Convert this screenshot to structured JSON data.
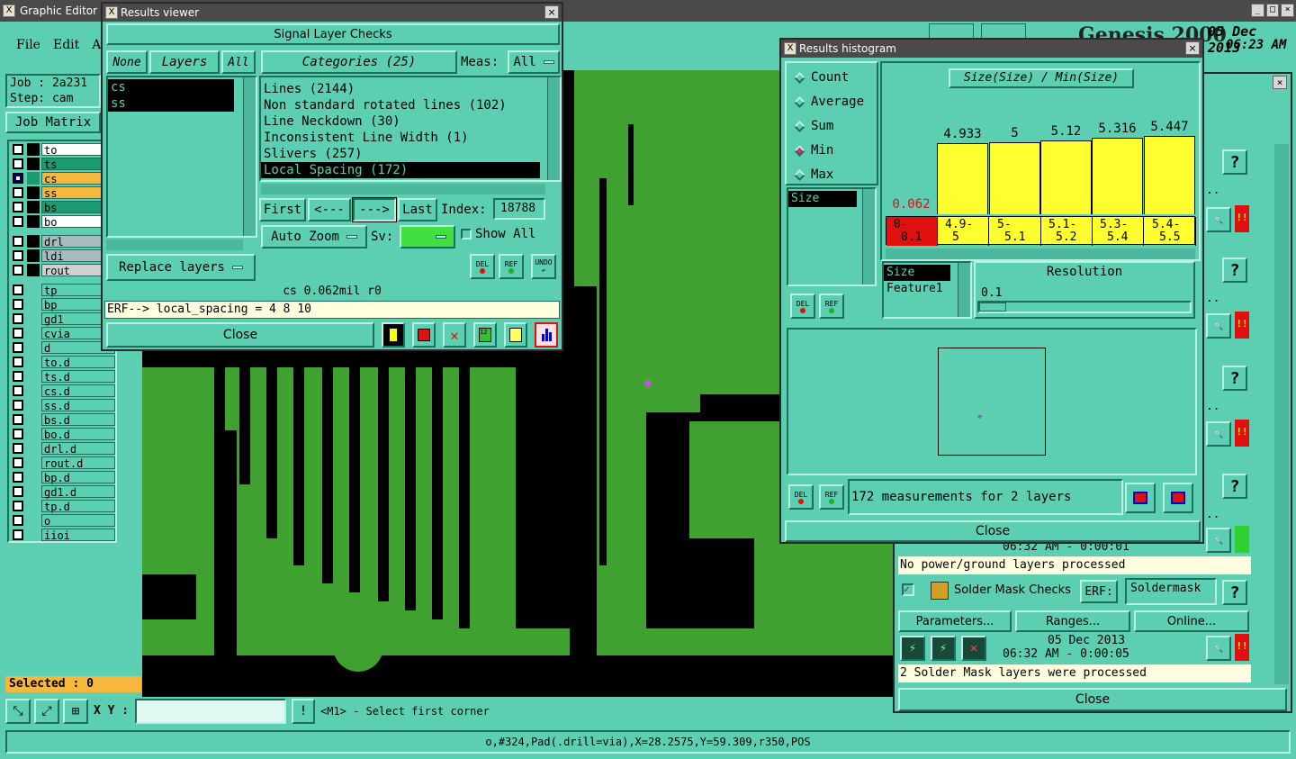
{
  "main": {
    "title": "Graphic Editor 9",
    "menu": [
      "File",
      "Edit",
      "A"
    ],
    "job_label": "Job : 2a231",
    "step_label": "Step: cam",
    "job_matrix": "Job Matrix",
    "genesis": "Genesis 2000",
    "date": "05 Dec 2013",
    "time": "06:23 AM",
    "selected": "Selected : 0",
    "xy_label": "X Y :",
    "xy_value": "",
    "prompt": "<M1> - Select first corner",
    "status": "o,#324,Pad(.drill=via),X=28.2575,Y=59.309,r350,POS"
  },
  "layers": [
    {
      "name": "to",
      "color": "#ffffff",
      "checked": false
    },
    {
      "name": "ts",
      "color": "#1c9a72",
      "checked": false
    },
    {
      "name": "cs",
      "color": "#f5b83c",
      "checked": true
    },
    {
      "name": "ss",
      "color": "#f5b83c",
      "checked": false
    },
    {
      "name": "bs",
      "color": "#1c9a72",
      "checked": false
    },
    {
      "name": "bo",
      "color": "#ffffff",
      "checked": false
    },
    {
      "name": "drl",
      "color": "#a8bcc0",
      "checked": false
    },
    {
      "name": "ldi",
      "color": "#a8bcc0",
      "checked": false
    },
    {
      "name": "rout",
      "color": "#d0d0d0",
      "checked": false
    },
    {
      "name": "tp",
      "color": "#5ccfb3",
      "checked": false
    },
    {
      "name": "bp",
      "color": "#5ccfb3",
      "checked": false
    },
    {
      "name": "gd1",
      "color": "#5ccfb3",
      "checked": false
    },
    {
      "name": "cvia",
      "color": "#5ccfb3",
      "checked": false
    },
    {
      "name": "d",
      "color": "#5ccfb3",
      "checked": false
    },
    {
      "name": "to.d",
      "color": "#5ccfb3",
      "checked": false
    },
    {
      "name": "ts.d",
      "color": "#5ccfb3",
      "checked": false
    },
    {
      "name": "cs.d",
      "color": "#5ccfb3",
      "checked": false
    },
    {
      "name": "ss.d",
      "color": "#5ccfb3",
      "checked": false
    },
    {
      "name": "bs.d",
      "color": "#5ccfb3",
      "checked": false
    },
    {
      "name": "bo.d",
      "color": "#5ccfb3",
      "checked": false
    },
    {
      "name": "drl.d",
      "color": "#5ccfb3",
      "checked": false
    },
    {
      "name": "rout.d",
      "color": "#5ccfb3",
      "checked": false
    },
    {
      "name": "bp.d",
      "color": "#5ccfb3",
      "checked": false
    },
    {
      "name": "gd1.d",
      "color": "#5ccfb3",
      "checked": false
    },
    {
      "name": "tp.d",
      "color": "#5ccfb3",
      "checked": false
    },
    {
      "name": "o",
      "color": "#5ccfb3",
      "checked": false
    },
    {
      "name": "iioi",
      "color": "#5ccfb3",
      "checked": false
    }
  ],
  "results_viewer": {
    "title": "Results viewer",
    "header": "Signal Layer Checks",
    "none": "None",
    "layers_label": "Layers",
    "all": "All",
    "categories_label": "Categories (25)",
    "meas_label": "Meas:",
    "meas_value": "All",
    "layer_items": [
      "cs",
      "ss"
    ],
    "category_items": [
      "Lines (2144)",
      "Non standard rotated lines (102)",
      "Line Neckdown (30)",
      "Inconsistent Line Width (1)",
      "Slivers (257)",
      "Local Spacing (172)"
    ],
    "first": "First",
    "prev": "<---",
    "next": "--->",
    "last": "Last",
    "index_label": "Index:",
    "index_value": "18788",
    "replace_layers": "Replace layers",
    "auto_zoom": "Auto Zoom",
    "sv_label": "Sv:",
    "show_all": "Show All",
    "del": "DEL",
    "ref": "REF",
    "undo": "UNDO",
    "info_line": "cs 0.062mil  r0",
    "erf_line": "ERF--> local_spacing = 4 8 10",
    "close": "Close"
  },
  "histogram": {
    "title": "Results histogram",
    "modes": [
      "Count",
      "Average",
      "Sum",
      "Min",
      "Max"
    ],
    "selected_mode": "Min",
    "chart_title": "Size(Size) / Min(Size)",
    "size_list": [
      "Size"
    ],
    "size_list2": [
      "Size",
      "Feature1"
    ],
    "resolution_label": "Resolution",
    "resolution_value": "0.1",
    "measurements": "172 measurements for 2 layers",
    "del": "DEL",
    "ref": "REF",
    "close": "Close"
  },
  "chart_data": {
    "type": "bar",
    "title": "Size(Size) / Min(Size)",
    "categories": [
      "0-0.1",
      "4.9-5",
      "5-5.1",
      "5.1-5.2",
      "5.3-5.4",
      "5.4-5.5"
    ],
    "values": [
      0.062,
      4.933,
      5,
      5.12,
      5.316,
      5.447
    ],
    "value_labels": [
      "0.062",
      "4.933",
      "5",
      "5.12",
      "5.316",
      "5.447"
    ],
    "bin_labels_line1": [
      "0-",
      "4.9-",
      "5-",
      "5.1-",
      "5.3-",
      "5.4-"
    ],
    "bin_labels_line2": [
      "0.1",
      "5",
      "5.1",
      "5.2",
      "5.4",
      "5.5"
    ],
    "ylim": [
      0,
      5.5
    ],
    "colors": {
      "highlight": "#e01010",
      "normal": "#ffff30"
    }
  },
  "checklist": {
    "no_power": "No power/ground layers processed",
    "time1": "06:32 AM - 0:00:01",
    "solder_title": "Solder Mask Checks",
    "erf_label": "ERF:",
    "erf_value": "Soldermask",
    "parameters": "Parameters...",
    "ranges": "Ranges...",
    "online": "Online...",
    "date": "05 Dec 2013",
    "time2": "06:32 AM - 0:00:05",
    "solder_status": "2 Solder Mask layers were processed",
    "close": "Close",
    "help": "?"
  }
}
